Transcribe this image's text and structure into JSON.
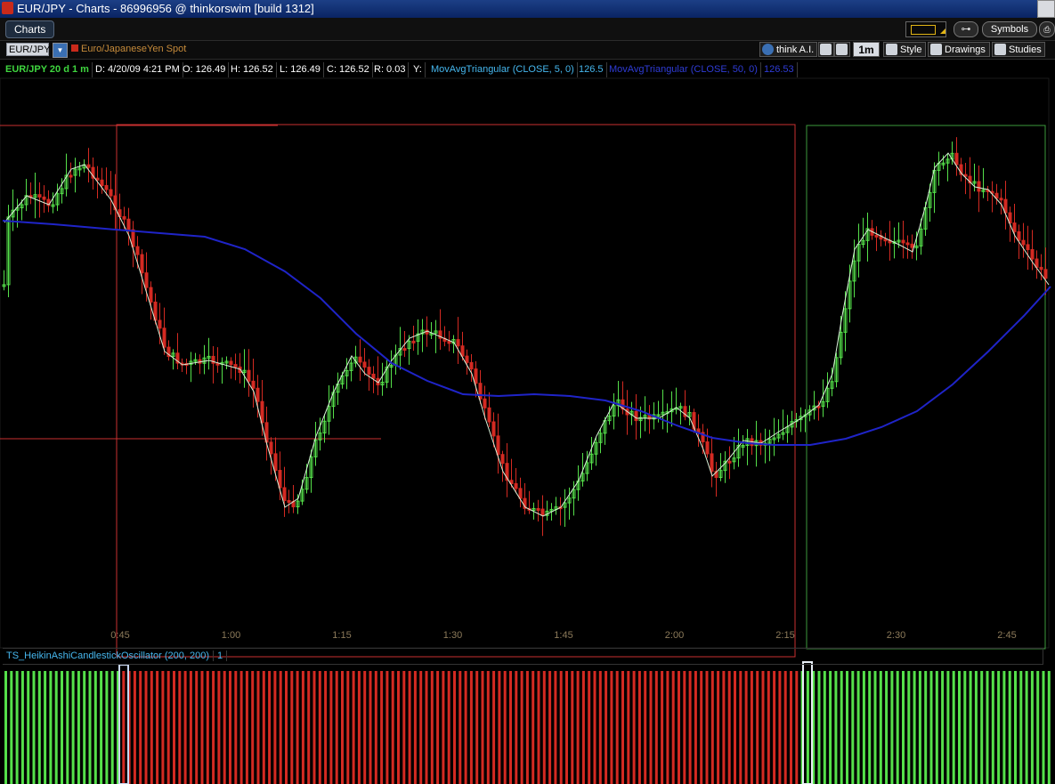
{
  "window": {
    "title": "EUR/JPY - Charts - 86996956 @ thinkorswim [build 1312]"
  },
  "toolbar": {
    "charts_tab": "Charts",
    "symbols_label": "Symbols",
    "print_label": "⎙"
  },
  "symbol": {
    "value": "EUR/JPY",
    "description": "Euro/JapaneseYen Spot"
  },
  "chart_toolbar": {
    "think_ai": "think A.I.",
    "period": "1m",
    "style": "Style",
    "drawings": "Drawings",
    "studies": "Studies"
  },
  "info": {
    "symbol_period": "EUR/JPY 20 d 1 m",
    "date": "D: 4/20/09 4:21 PM",
    "open": "O: 126.49",
    "high": "H: 126.52",
    "low": "L: 126.49",
    "close": "C: 126.52",
    "range": "R: 0.03",
    "y": "Y:",
    "ma5_label": "MovAvgTriangular (CLOSE, 5, 0)",
    "ma5_value": "126.5",
    "ma50_label": "MovAvgTriangular (CLOSE, 50, 0)",
    "ma50_value": "126.53"
  },
  "colors": {
    "up": "#55e04a",
    "down": "#d42a22",
    "ma_fast": "#d8f0d8",
    "ma_slow": "#1f24c8",
    "box_red": "#c93131",
    "box_green": "#3d9a3d",
    "time_label": "#8c7a5a",
    "info_cyan": "#46b7ee",
    "info_blue": "#2f3cd6"
  },
  "time_axis": {
    "labels": [
      "0:45",
      "1:00",
      "1:15",
      "1:30",
      "1:45",
      "2:00",
      "2:15",
      "2:30",
      "2:45"
    ]
  },
  "oscillator": {
    "label": "TS_HeikinAshiCandlestickOscillator (200, 200)",
    "value": "1",
    "sequence": [
      {
        "state": "up",
        "count": 21
      },
      {
        "state": "down",
        "count": 121
      },
      {
        "state": "up",
        "count": 45
      }
    ]
  }
}
